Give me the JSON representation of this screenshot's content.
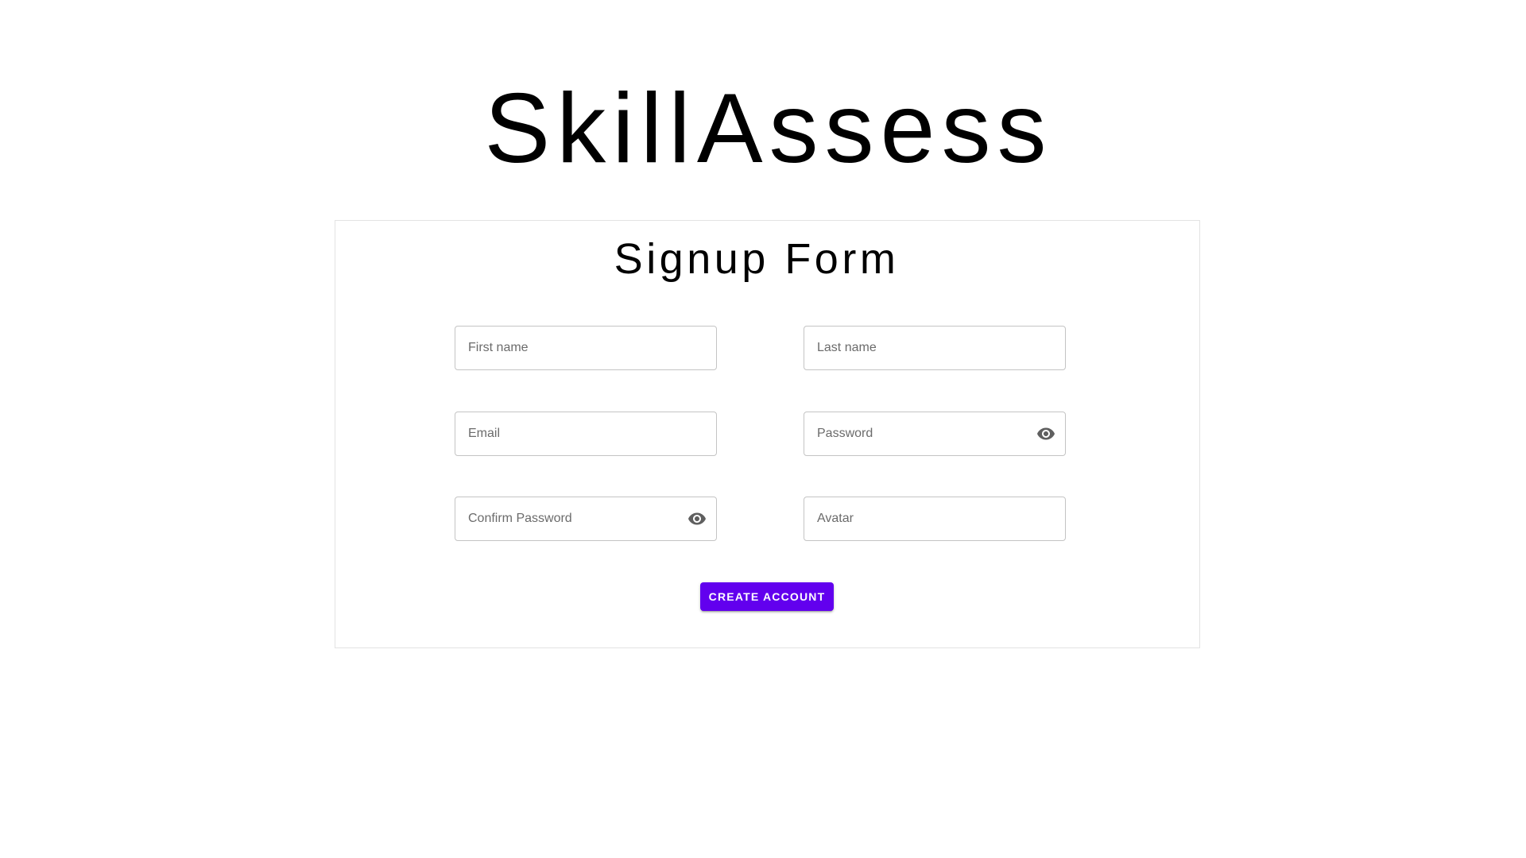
{
  "app": {
    "title": "SkillAssess"
  },
  "form": {
    "title": "Signup Form",
    "fields": {
      "first_name": {
        "placeholder": "First name",
        "value": ""
      },
      "last_name": {
        "placeholder": "Last name",
        "value": ""
      },
      "email": {
        "placeholder": "Email",
        "value": ""
      },
      "password": {
        "placeholder": "Password",
        "value": "",
        "icon": "eye-icon"
      },
      "confirm_password": {
        "placeholder": "Confirm Password",
        "value": "",
        "icon": "eye-icon"
      },
      "avatar": {
        "placeholder": "Avatar",
        "value": ""
      }
    },
    "submit_label": "CREATE ACCOUNT"
  },
  "colors": {
    "accent": "#6200ee",
    "card_border": "#e3e3e3",
    "field_border": "#c4c4c4",
    "icon": "#5f5f5f"
  }
}
